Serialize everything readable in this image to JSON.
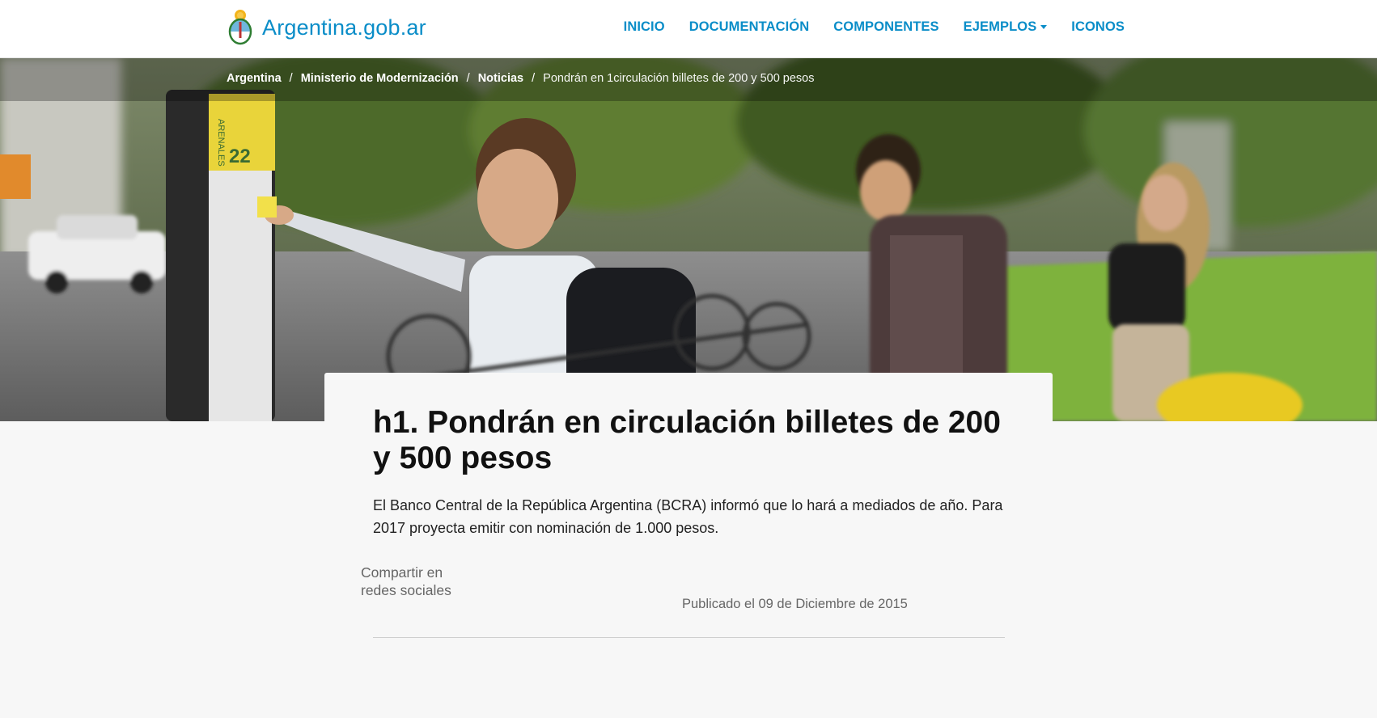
{
  "header": {
    "brand": "Argentina.gob.ar",
    "nav": [
      "INICIO",
      "DOCUMENTACIÓN",
      "COMPONENTES",
      "EJEMPLOS",
      "ICONOS"
    ]
  },
  "breadcrumb": {
    "items": [
      "Argentina",
      "Ministerio de Modernización",
      "Noticias"
    ],
    "current": "Pondrán en 1circulación billetes de 200 y 500 pesos",
    "separator": "/"
  },
  "article": {
    "title": "h1. Pondrán en circulación billetes de 200 y 500 pesos",
    "lead": "El Banco Central de la República Argentina (BCRA) informó que lo hará a mediados de año. Para 2017 proyecta emitir con nominación de 1.000 pesos.",
    "share_label": "Compartir en redes sociales",
    "published": "Publicado el 09 de Diciembre de 2015"
  },
  "hero_image": {
    "sign_label": "ARENALES",
    "sign_number": "22"
  },
  "colors": {
    "brand": "#0a8dc8",
    "background": "#f7f7f7"
  }
}
